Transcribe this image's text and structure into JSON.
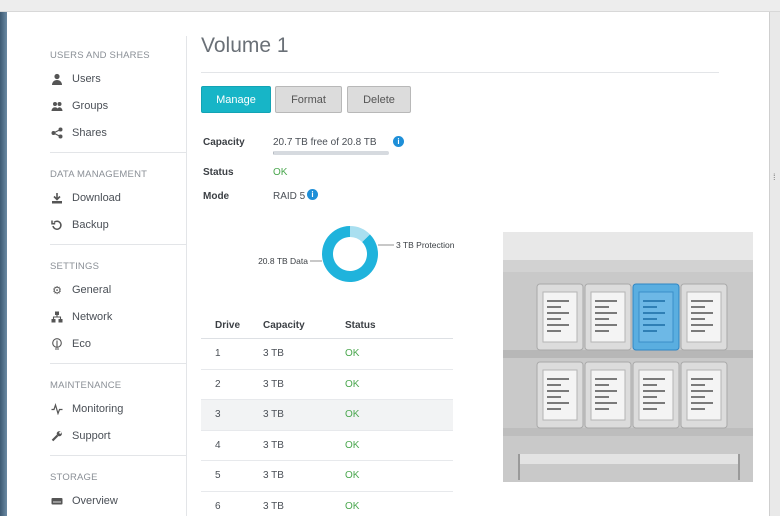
{
  "sidebar": {
    "sections": [
      {
        "title": "USERS AND SHARES",
        "items": [
          {
            "label": "Users",
            "icon": "user-icon"
          },
          {
            "label": "Groups",
            "icon": "groups-icon"
          },
          {
            "label": "Shares",
            "icon": "share-icon"
          }
        ]
      },
      {
        "title": "DATA MANAGEMENT",
        "items": [
          {
            "label": "Download",
            "icon": "download-icon"
          },
          {
            "label": "Backup",
            "icon": "backup-icon"
          }
        ]
      },
      {
        "title": "SETTINGS",
        "items": [
          {
            "label": "General",
            "icon": "gear-icon"
          },
          {
            "label": "Network",
            "icon": "network-icon"
          },
          {
            "label": "Eco",
            "icon": "eco-icon"
          }
        ]
      },
      {
        "title": "MAINTENANCE",
        "items": [
          {
            "label": "Monitoring",
            "icon": "pulse-icon"
          },
          {
            "label": "Support",
            "icon": "wrench-icon"
          }
        ]
      },
      {
        "title": "STORAGE",
        "items": [
          {
            "label": "Overview",
            "icon": "drive-icon"
          }
        ]
      }
    ]
  },
  "main": {
    "title": "Volume 1",
    "buttons": {
      "manage": "Manage",
      "format": "Format",
      "delete": "Delete"
    },
    "properties": {
      "capacity_label": "Capacity",
      "capacity_value": "20.7 TB free of 20.8 TB",
      "capacity_used_fraction": 0.005,
      "status_label": "Status",
      "status_value": "OK",
      "mode_label": "Mode",
      "mode_value": "RAID 5"
    },
    "donut": {
      "data_label": "20.8 TB Data",
      "protection_label": "3 TB Protection",
      "data_tb": 20.8,
      "protection_tb": 3,
      "data_color": "#1fb3dc",
      "protection_color": "#a9dff0"
    },
    "table": {
      "headers": [
        "Drive",
        "Capacity",
        "Status"
      ],
      "rows": [
        [
          "1",
          "3 TB",
          "OK"
        ],
        [
          "2",
          "3 TB",
          "OK"
        ],
        [
          "3",
          "3 TB",
          "OK"
        ],
        [
          "4",
          "3 TB",
          "OK"
        ],
        [
          "5",
          "3 TB",
          "OK"
        ],
        [
          "6",
          "3 TB",
          "OK"
        ]
      ]
    },
    "enclosure": {
      "selected_slot": 3,
      "highlight_color": "#5aaee0"
    }
  }
}
